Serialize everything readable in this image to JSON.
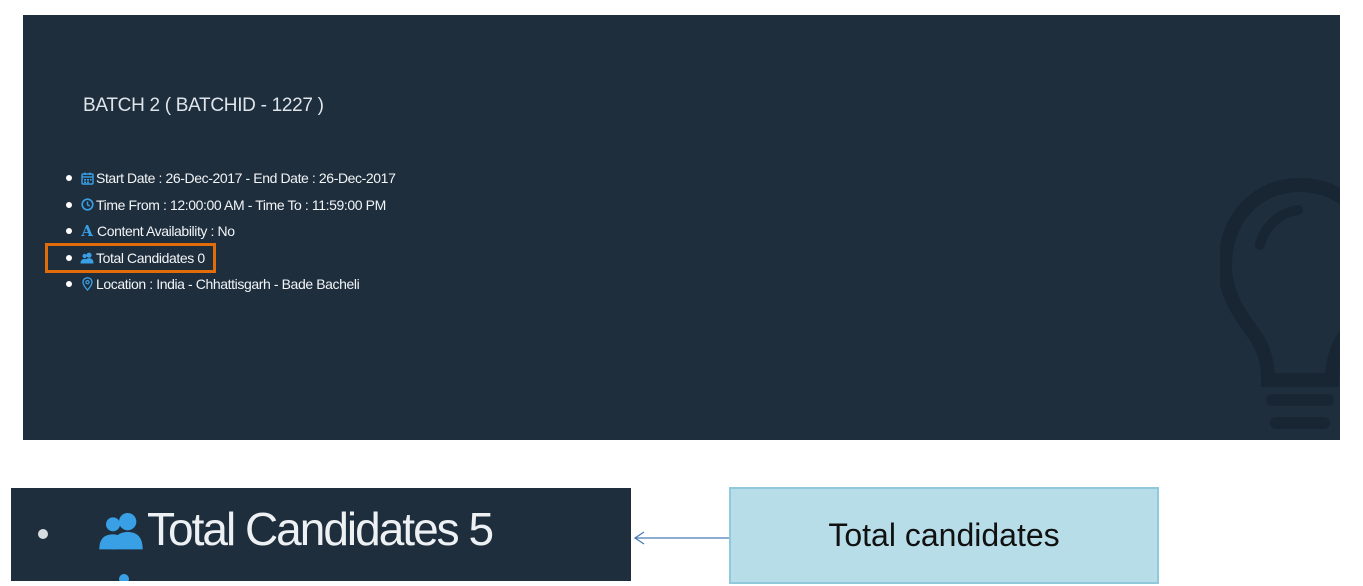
{
  "batch": {
    "title": "BATCH 2 ( BATCHID - 1227 )",
    "details": [
      {
        "icon": "calendar-icon",
        "text": "Start Date : 26-Dec-2017 - End Date : 26-Dec-2017"
      },
      {
        "icon": "clock-icon",
        "text": "Time From : 12:00:00 AM - Time To : 11:59:00 PM"
      },
      {
        "icon": "letter-a-icon",
        "glyph": "A",
        "text": "Content Availability : No"
      },
      {
        "icon": "users-icon",
        "text": "Total Candidates 0"
      },
      {
        "icon": "location-pin-icon",
        "text": "Location : India - Chhattisgarh - Bade Bacheli"
      }
    ]
  },
  "zoom": {
    "icon": "users-icon",
    "text": "Total Candidates 5"
  },
  "callout": {
    "text": "Total candidates"
  },
  "colors": {
    "panel_background": "#1e2e3d",
    "icon_accent": "#3aa0e6",
    "highlight_border": "#e36c0a",
    "callout_background": "#b7dde8",
    "callout_border": "#8fc9db",
    "arrow": "#4a7ab8"
  }
}
